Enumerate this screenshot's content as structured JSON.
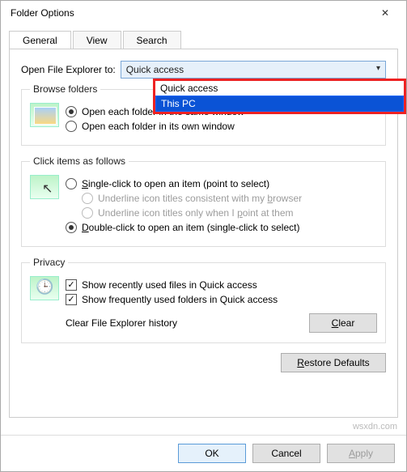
{
  "window": {
    "title": "Folder Options"
  },
  "tabs": {
    "general": "General",
    "view": "View",
    "search": "Search"
  },
  "openExplorer": {
    "label": "Open File Explorer to:",
    "selected": "Quick access",
    "options": {
      "opt0": "Quick access",
      "opt1": "This PC"
    }
  },
  "browseFolders": {
    "legend": "Browse folders",
    "sameWindow": "Open each folder in the same window",
    "ownWindow": "Open each folder in its own window"
  },
  "clickItems": {
    "legend": "Click items as follows",
    "single_pre": "",
    "single_u": "S",
    "single_post": "ingle-click to open an item (point to select)",
    "under_browser_pre": "Underline icon titles consistent with my ",
    "under_browser_u": "b",
    "under_browser_post": "rowser",
    "under_point_pre": "Underline icon titles only when I ",
    "under_point_u": "p",
    "under_point_post": "oint at them",
    "double_pre": "",
    "double_u": "D",
    "double_post": "ouble-click to open an item (single-click to select)"
  },
  "privacy": {
    "legend": "Privacy",
    "recentFiles": "Show recently used files in Quick access",
    "frequentFolders": "Show frequently used folders in Quick access",
    "clearLabel": "Clear File Explorer history",
    "clearBtn_u": "C",
    "clearBtn_post": "lear"
  },
  "restore": {
    "u": "R",
    "post": "estore Defaults"
  },
  "footer": {
    "ok": "OK",
    "cancel": "Cancel",
    "apply_u": "A",
    "apply_post": "pply"
  },
  "watermark": "wsxdn.com"
}
